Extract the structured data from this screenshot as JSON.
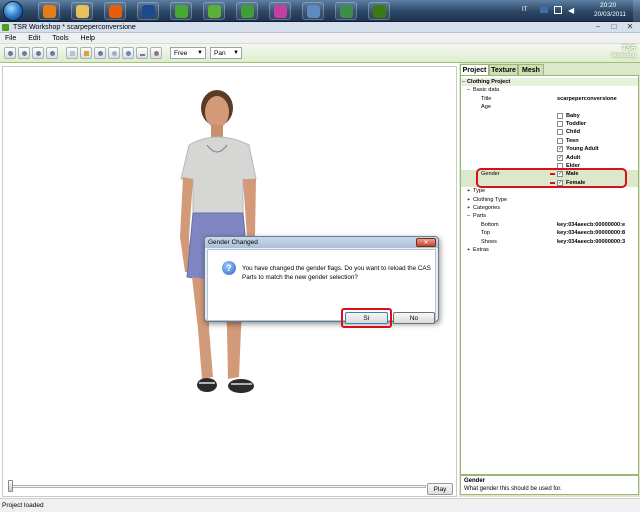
{
  "taskbar": {
    "start_icon": "windows-orb",
    "apps": [
      {
        "name": "media-player-icon",
        "color": "#e87d16"
      },
      {
        "name": "file-explorer-icon",
        "color": "#e6c35a"
      },
      {
        "name": "firefox-icon",
        "color": "#e85d0c"
      },
      {
        "name": "photoshop-icon",
        "color": "#1c4a8e"
      },
      {
        "name": "sims-launcher-icon-1",
        "color": "#4aa935"
      },
      {
        "name": "sims-launcher-icon-2",
        "color": "#59b13a"
      },
      {
        "name": "sims-launcher-icon-3",
        "color": "#3f9d3a"
      },
      {
        "name": "sims-launcher-icon-4",
        "color": "#c63fa0"
      },
      {
        "name": "steam-like-icon",
        "color": "#5b8bc0"
      },
      {
        "name": "sims-community-icon",
        "color": "#3f8d4a"
      },
      {
        "name": "tsr-workshop-icon",
        "color": "#3b7a10"
      }
    ],
    "language": "IT",
    "clock_time": "20:20",
    "clock_date": "20/03/2011"
  },
  "window": {
    "title": "TSR Workshop * scarpeperconversione"
  },
  "menu": [
    "File",
    "Edit",
    "Tools",
    "Help"
  ],
  "toolbar": {
    "camera_mode": "Free",
    "pan_mode": "Pan",
    "logo_line1": "TSR",
    "logo_line2": "Workshop"
  },
  "viewport": {
    "play_label": "Play",
    "slider_position": 0
  },
  "panel": {
    "tabs": [
      "Project",
      "Texture",
      "Mesh"
    ],
    "active_tab": "Project",
    "tree": {
      "root": "Clothing Project",
      "basic_data": "Basic data",
      "title_label": "Title",
      "title_value": "scarpeperconversione",
      "age_label": "Age",
      "ages": [
        {
          "label": "Baby",
          "checked": false
        },
        {
          "label": "Toddler",
          "checked": false
        },
        {
          "label": "Child",
          "checked": false
        },
        {
          "label": "Teen",
          "checked": false
        },
        {
          "label": "Young Adult",
          "checked": true
        },
        {
          "label": "Adult",
          "checked": true
        },
        {
          "label": "Elder",
          "checked": false
        }
      ],
      "gender_label": "Gender",
      "genders": [
        {
          "label": "Male",
          "checked": true
        },
        {
          "label": "Female",
          "checked": true
        }
      ],
      "groups_a": [
        "Type",
        "Clothing Type",
        "Categories"
      ],
      "parts_label": "Parts",
      "parts": [
        {
          "label": "Bottom",
          "value": "key:034aeecb:00000000:e"
        },
        {
          "label": "Top",
          "value": "key:034aeecb:00000000:8"
        },
        {
          "label": "Shoes",
          "value": "key:034aeecb:00000000:3"
        }
      ],
      "extras": "Extras"
    },
    "help_title": "Gender",
    "help_text": "What gender this should be used for."
  },
  "dialog": {
    "title": "Gender Changed",
    "message": "You have changed the gender flags. Do you want to reload the CAS Parts to match the new gender selection?",
    "yes_label": "Sì",
    "no_label": "No"
  },
  "status": "Project loaded",
  "colors": {
    "accent_green": "#9fc46e",
    "highlight_red": "#d8101c"
  }
}
